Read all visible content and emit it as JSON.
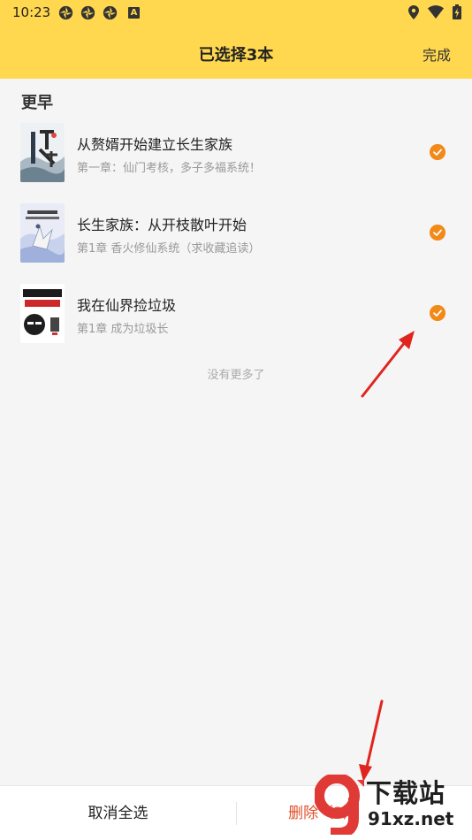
{
  "status_bar": {
    "time": "10:23",
    "app_badge": "A"
  },
  "header": {
    "title": "已选择3本",
    "done_label": "完成"
  },
  "section_title": "更早",
  "books": [
    {
      "title": "从赘婿开始建立长生家族",
      "chapter": "第一章：仙门考核，多子多福系统！",
      "checked": true
    },
    {
      "title": "长生家族：从开枝散叶开始",
      "chapter": "第1章 香火修仙系统（求收藏追读）",
      "checked": true
    },
    {
      "title": "我在仙界捡垃圾",
      "chapter": "第1章 成为垃圾长",
      "checked": true
    }
  ],
  "end_text": "没有更多了",
  "bottom": {
    "cancel_all": "取消全选",
    "delete_label": "删除（3）"
  },
  "watermark": {
    "brand": "下载站",
    "url": "91xz.net"
  },
  "colors": {
    "header_bg": "#ffd84f",
    "check": "#f28a1a",
    "delete": "#e0502a",
    "arrow": "#e0251f"
  }
}
